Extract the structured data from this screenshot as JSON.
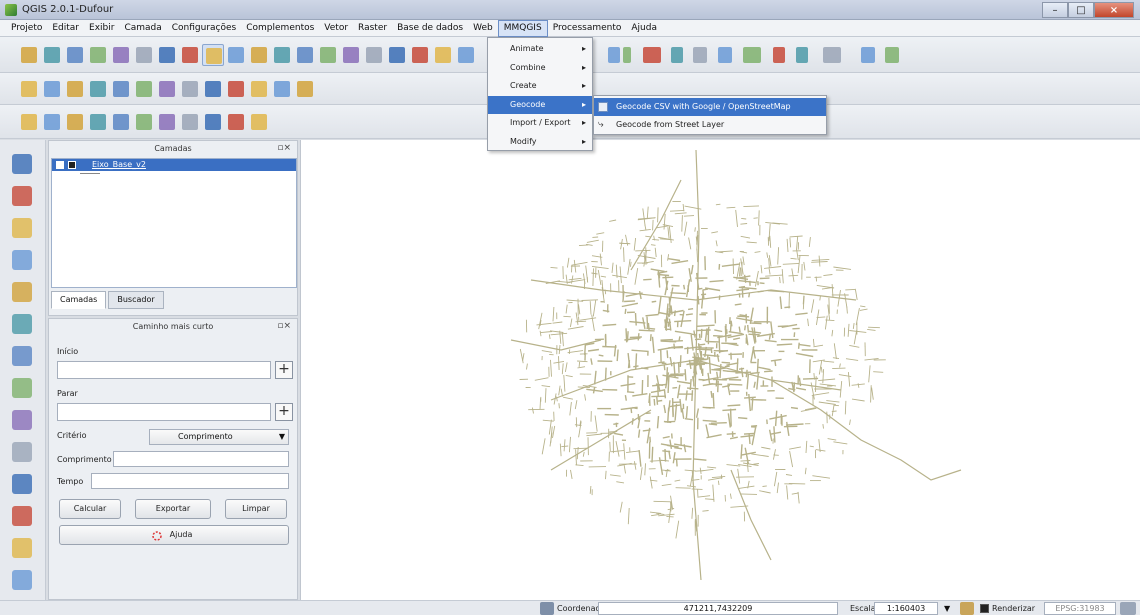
{
  "window": {
    "title": "QGIS 2.0.1-Dufour",
    "close_label": "×"
  },
  "colors": {
    "road": "#b7b28a",
    "highlight": "#3b73c8",
    "canvas": "#ffffff"
  },
  "menu": {
    "items": [
      "Projeto",
      "Editar",
      "Exibir",
      "Camada",
      "Configurações",
      "Complementos",
      "Vetor",
      "Raster",
      "Base de dados",
      "Web",
      "MMQGIS",
      "Processamento",
      "Ajuda"
    ],
    "active": "MMQGIS"
  },
  "mmqgis_menu": {
    "items": [
      {
        "label": "Animate",
        "arrow": "▸"
      },
      {
        "label": "Combine",
        "arrow": "▸"
      },
      {
        "label": "Create",
        "arrow": "▸"
      },
      {
        "label": "Geocode",
        "arrow": "▸"
      },
      {
        "label": "Import / Export",
        "arrow": "▸"
      },
      {
        "label": "Modify",
        "arrow": "▸"
      }
    ],
    "highlighted": "Geocode"
  },
  "geocode_submenu": {
    "items": [
      {
        "label": "Geocode CSV with Google / OpenStreetMap",
        "icon": "geocode-csv-icon"
      },
      {
        "label": "Geocode from Street Layer",
        "icon": "street-layer-icon"
      }
    ]
  },
  "layers_panel": {
    "title": "Camadas",
    "controls": "▫×",
    "layer_name": "Eixo_Base_v2",
    "tabs": [
      "Camadas",
      "Buscador"
    ]
  },
  "route_panel": {
    "title": "Caminho mais curto",
    "controls": "▫×",
    "start_label": "Início",
    "start_value": "",
    "stop_label": "Parar",
    "stop_value": "",
    "plus": "+",
    "criterion_label": "Critério",
    "criterion_value": "Comprimento",
    "length_label": "Comprimento",
    "length_value": "",
    "time_label": "Tempo",
    "time_value": "",
    "calc_button": "Calcular",
    "export_button": "Exportar",
    "clear_button": "Limpar",
    "help_button": "Ajuda"
  },
  "statusbar": {
    "coord_label": "Coordenada:",
    "coord_value": "471211,7432209",
    "scale_label": "Escala",
    "scale_value": "1:160403",
    "render_label": "Renderizar",
    "epsg_value": "EPSG:31983"
  }
}
